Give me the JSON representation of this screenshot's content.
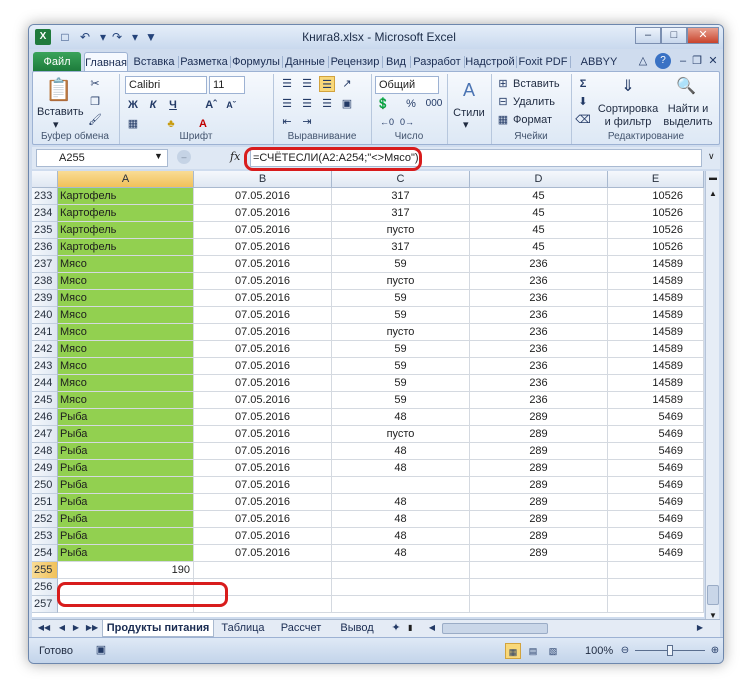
{
  "window": {
    "title": "Книга8.xlsx - Microsoft Excel"
  },
  "quick_access": {
    "icons": [
      "excel-icon",
      "save-icon",
      "undo-icon",
      "redo-icon",
      "customize-icon"
    ]
  },
  "tabs": [
    "Файл",
    "Главная",
    "Вставка",
    "Разметка",
    "Формулы",
    "Данные",
    "Рецензир",
    "Вид",
    "Разработ",
    "Надстрой",
    "Foxit PDF",
    "ABBYY PDF"
  ],
  "ribbon": {
    "clipboard": {
      "paste_label": "Вставить",
      "group_label": "Буфер обмена"
    },
    "font": {
      "name": "Calibri",
      "size": "11",
      "bold": "Ж",
      "italic": "К",
      "underline": "Ч",
      "group_label": "Шрифт"
    },
    "alignment": {
      "group_label": "Выравнивание"
    },
    "number": {
      "format": "Общий",
      "percent": "%",
      "thousands": "000",
      "group_label": "Число"
    },
    "styles": {
      "label": "Стили"
    },
    "cells": {
      "insert": "Вставить",
      "delete": "Удалить",
      "format": "Формат",
      "group_label": "Ячейки"
    },
    "editing": {
      "sort_label_1": "Сортировка",
      "sort_label_2": "и фильтр",
      "find_label_1": "Найти и",
      "find_label_2": "выделить",
      "group_label": "Редактирование"
    }
  },
  "formula_bar": {
    "name_box": "A255",
    "fx": "fx",
    "formula": "=СЧЁТЕСЛИ(A2:A254;\"<>Мясо\")"
  },
  "columns": [
    "A",
    "B",
    "C",
    "D",
    "E"
  ],
  "rows": [
    {
      "num": "233",
      "a": "Картофель",
      "b": "07.05.2016",
      "c": "317",
      "d": "45",
      "e": "10526"
    },
    {
      "num": "234",
      "a": "Картофель",
      "b": "07.05.2016",
      "c": "317",
      "d": "45",
      "e": "10526"
    },
    {
      "num": "235",
      "a": "Картофель",
      "b": "07.05.2016",
      "c": "пусто",
      "d": "45",
      "e": "10526"
    },
    {
      "num": "236",
      "a": "Картофель",
      "b": "07.05.2016",
      "c": "317",
      "d": "45",
      "e": "10526"
    },
    {
      "num": "237",
      "a": "Мясо",
      "b": "07.05.2016",
      "c": "59",
      "d": "236",
      "e": "14589"
    },
    {
      "num": "238",
      "a": "Мясо",
      "b": "07.05.2016",
      "c": "пусто",
      "d": "236",
      "e": "14589"
    },
    {
      "num": "239",
      "a": "Мясо",
      "b": "07.05.2016",
      "c": "59",
      "d": "236",
      "e": "14589"
    },
    {
      "num": "240",
      "a": "Мясо",
      "b": "07.05.2016",
      "c": "59",
      "d": "236",
      "e": "14589"
    },
    {
      "num": "241",
      "a": "Мясо",
      "b": "07.05.2016",
      "c": "пусто",
      "d": "236",
      "e": "14589"
    },
    {
      "num": "242",
      "a": "Мясо",
      "b": "07.05.2016",
      "c": "59",
      "d": "236",
      "e": "14589"
    },
    {
      "num": "243",
      "a": "Мясо",
      "b": "07.05.2016",
      "c": "59",
      "d": "236",
      "e": "14589"
    },
    {
      "num": "244",
      "a": "Мясо",
      "b": "07.05.2016",
      "c": "59",
      "d": "236",
      "e": "14589"
    },
    {
      "num": "245",
      "a": "Мясо",
      "b": "07.05.2016",
      "c": "59",
      "d": "236",
      "e": "14589"
    },
    {
      "num": "246",
      "a": "Рыба",
      "b": "07.05.2016",
      "c": "48",
      "d": "289",
      "e": "5469"
    },
    {
      "num": "247",
      "a": "Рыба",
      "b": "07.05.2016",
      "c": "пусто",
      "d": "289",
      "e": "5469"
    },
    {
      "num": "248",
      "a": "Рыба",
      "b": "07.05.2016",
      "c": "48",
      "d": "289",
      "e": "5469"
    },
    {
      "num": "249",
      "a": "Рыба",
      "b": "07.05.2016",
      "c": "48",
      "d": "289",
      "e": "5469"
    },
    {
      "num": "250",
      "a": "Рыба",
      "b": "07.05.2016",
      "c": "",
      "d": "289",
      "e": "5469"
    },
    {
      "num": "251",
      "a": "Рыба",
      "b": "07.05.2016",
      "c": "48",
      "d": "289",
      "e": "5469"
    },
    {
      "num": "252",
      "a": "Рыба",
      "b": "07.05.2016",
      "c": "48",
      "d": "289",
      "e": "5469"
    },
    {
      "num": "253",
      "a": "Рыба",
      "b": "07.05.2016",
      "c": "48",
      "d": "289",
      "e": "5469"
    },
    {
      "num": "254",
      "a": "Рыба",
      "b": "07.05.2016",
      "c": "48",
      "d": "289",
      "e": "5469"
    },
    {
      "num": "255",
      "a": "190",
      "b": "",
      "c": "",
      "d": "",
      "e": ""
    },
    {
      "num": "256",
      "a": "",
      "b": "",
      "c": "",
      "d": "",
      "e": ""
    },
    {
      "num": "257",
      "a": "",
      "b": "",
      "c": "",
      "d": "",
      "e": ""
    }
  ],
  "sheets": [
    "Продукты питания",
    "Таблица",
    "Рассчет",
    "Вывод"
  ],
  "status": {
    "ready": "Готово",
    "zoom": "100%"
  },
  "colors": {
    "highlight_green": "#92d050",
    "annotation_red": "#d81c1c",
    "file_tab": "#1c7a3a"
  }
}
